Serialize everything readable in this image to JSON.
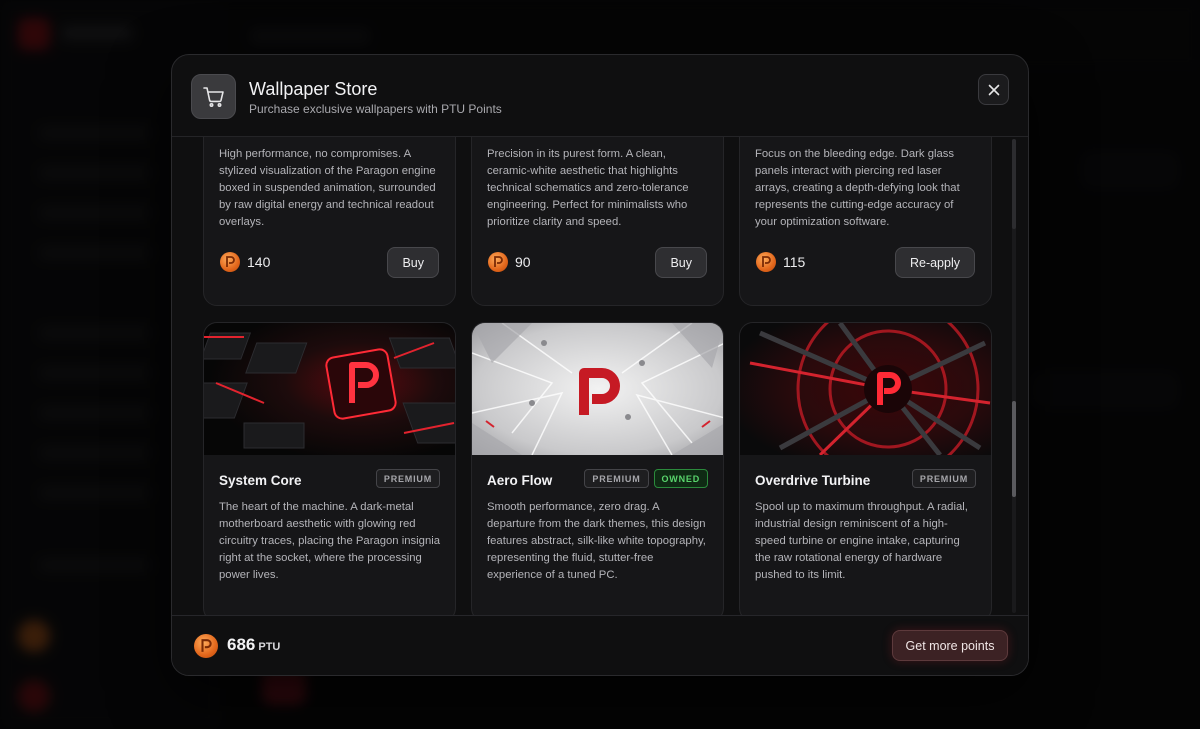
{
  "modal": {
    "title": "Wallpaper Store",
    "subtitle": "Purchase exclusive wallpapers with PTU Points",
    "close_icon": "close-icon",
    "cart_icon": "shopping-cart-icon"
  },
  "top_cards": [
    {
      "description": "High performance, no compromises. A stylized visualization of the Paragon engine boxed in suspended animation, surrounded by raw digital energy and technical readout overlays.",
      "price": "140",
      "action": "Buy"
    },
    {
      "description": "Precision in its purest form. A clean, ceramic-white aesthetic that highlights technical schematics and zero-tolerance engineering. Perfect for minimalists who prioritize clarity and speed.",
      "price": "90",
      "action": "Buy"
    },
    {
      "description": "Focus on the bleeding edge. Dark glass panels interact with piercing red laser arrays, creating a depth-defying look that represents the cutting-edge accuracy of your optimization software.",
      "price": "115",
      "action": "Re-apply"
    }
  ],
  "bottom_cards": [
    {
      "name": "System Core",
      "badges": [
        "PREMIUM"
      ],
      "description": "The heart of the machine. A dark-metal motherboard aesthetic with glowing red circuitry traces, placing the Paragon insignia right at the socket, where the processing power lives."
    },
    {
      "name": "Aero Flow",
      "badges": [
        "PREMIUM",
        "OWNED"
      ],
      "description": "Smooth performance, zero drag. A departure from the dark themes, this design features abstract, silk-like white topography, representing the fluid, stutter-free experience of a tuned PC."
    },
    {
      "name": "Overdrive Turbine",
      "badges": [
        "PREMIUM"
      ],
      "description": "Spool up to maximum throughput. A radial, industrial design reminiscent of a high-speed turbine or engine intake, capturing the raw rotational energy of hardware pushed to its limit."
    }
  ],
  "footer": {
    "balance": "686",
    "unit": "PTU",
    "get_more_label": "Get more points"
  },
  "colors": {
    "accent_red": "#c8202c",
    "coin_orange": "#e2661b",
    "owned_green": "#59d46c"
  }
}
